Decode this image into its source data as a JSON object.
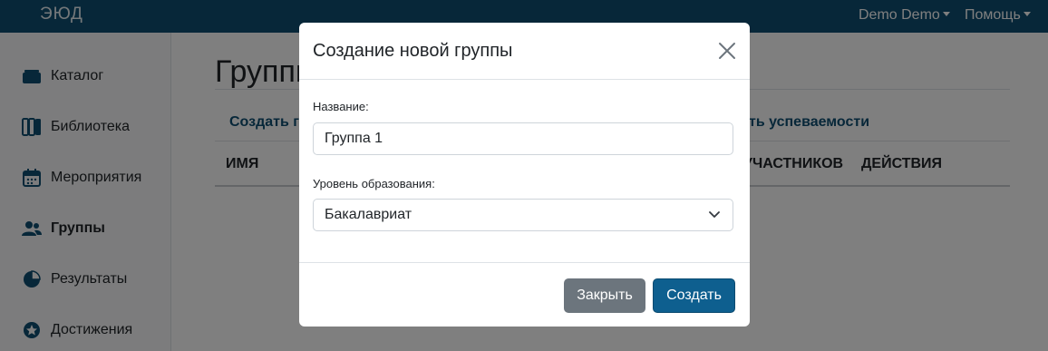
{
  "header": {
    "logo_text": "ЭЮД",
    "user_menu": "Demo Demo",
    "help_menu": "Помощь"
  },
  "sidebar": {
    "items": [
      {
        "label": "Каталог",
        "icon": "catalog-icon"
      },
      {
        "label": "Библиотека",
        "icon": "library-icon"
      },
      {
        "label": "Мероприятия",
        "icon": "calendar-icon"
      },
      {
        "label": "Группы",
        "icon": "users-icon",
        "active": true
      },
      {
        "label": "Результаты",
        "icon": "pie-chart-icon"
      },
      {
        "label": "Достижения",
        "icon": "star-icon"
      }
    ]
  },
  "main": {
    "title": "Группы",
    "create_link": "Создать гр",
    "perf_link": "ть успеваемости",
    "columns": {
      "name": "Имя",
      "participants": "участников",
      "actions": "Действия"
    }
  },
  "modal": {
    "title": "Создание новой группы",
    "name_label": "Название:",
    "name_value": "Группа 1",
    "level_label": "Уровень образования:",
    "level_value": "Бакалавриат",
    "close_button": "Закрыть",
    "create_button": "Создать"
  },
  "colors": {
    "brand": "#0e4f73",
    "primary_button": "#0e5f8f",
    "secondary_button": "#6c757d"
  }
}
